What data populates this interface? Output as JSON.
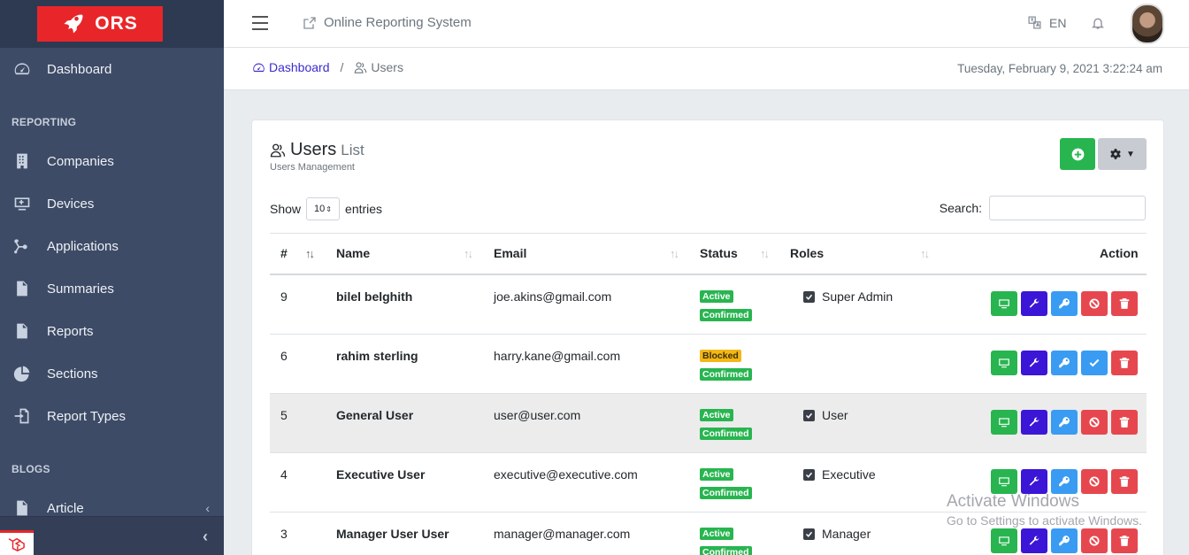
{
  "brand": {
    "name": "ORS"
  },
  "sidebar": {
    "items": [
      {
        "label": "Dashboard",
        "icon": "speedometer-icon"
      },
      {
        "label": "Companies",
        "icon": "building-icon"
      },
      {
        "label": "Devices",
        "icon": "monitor-icon"
      },
      {
        "label": "Applications",
        "icon": "hub-icon"
      },
      {
        "label": "Summaries",
        "icon": "file-info-icon"
      },
      {
        "label": "Reports",
        "icon": "file-icon"
      },
      {
        "label": "Sections",
        "icon": "pie-icon"
      },
      {
        "label": "Report Types",
        "icon": "import-icon"
      },
      {
        "label": "Article",
        "icon": "file-icon"
      }
    ],
    "headers": {
      "reporting": "REPORTING",
      "blogs": "BLOGS"
    },
    "collapse": "‹"
  },
  "topbar": {
    "site_link": "Online Reporting System",
    "lang": "EN"
  },
  "breadcrumb": {
    "home": "Dashboard",
    "separator": "/",
    "current": "Users"
  },
  "datetime": "Tuesday, February 9, 2021 3:22:24 am",
  "card": {
    "title": "Users",
    "title_suffix": "List",
    "subtitle": "Users Management"
  },
  "controls": {
    "show": "Show",
    "entries_value": "10",
    "entries": "entries",
    "search_label": "Search:",
    "search_value": ""
  },
  "table": {
    "headers": {
      "num": "#",
      "name": "Name",
      "email": "Email",
      "status": "Status",
      "roles": "Roles",
      "action": "Action"
    },
    "rows": [
      {
        "id": "9",
        "name": "bilel belghith",
        "email": "joe.akins@gmail.com",
        "status": "Active",
        "confirm": "Confirmed",
        "role": "Super Admin"
      },
      {
        "id": "6",
        "name": "rahim sterling",
        "email": "harry.kane@gmail.com",
        "status": "Blocked",
        "confirm": "Confirmed",
        "role": ""
      },
      {
        "id": "5",
        "name": "General User",
        "email": "user@user.com",
        "status": "Active",
        "confirm": "Confirmed",
        "role": "User"
      },
      {
        "id": "4",
        "name": "Executive User",
        "email": "executive@executive.com",
        "status": "Active",
        "confirm": "Confirmed",
        "role": "Executive"
      },
      {
        "id": "3",
        "name": "Manager User User",
        "email": "manager@manager.com",
        "status": "Active",
        "confirm": "Confirmed",
        "role": "Manager"
      }
    ]
  },
  "watermark": {
    "line1": "Activate Windows",
    "line2": "Go to Settings to activate Windows."
  },
  "colors": {
    "sidebar": "#3d4b66",
    "brand": "#e8262a",
    "green": "#28b550",
    "purple": "#3b16d6",
    "blue": "#3a9bf2",
    "red": "#e6474f",
    "yellow": "#f3b716"
  }
}
